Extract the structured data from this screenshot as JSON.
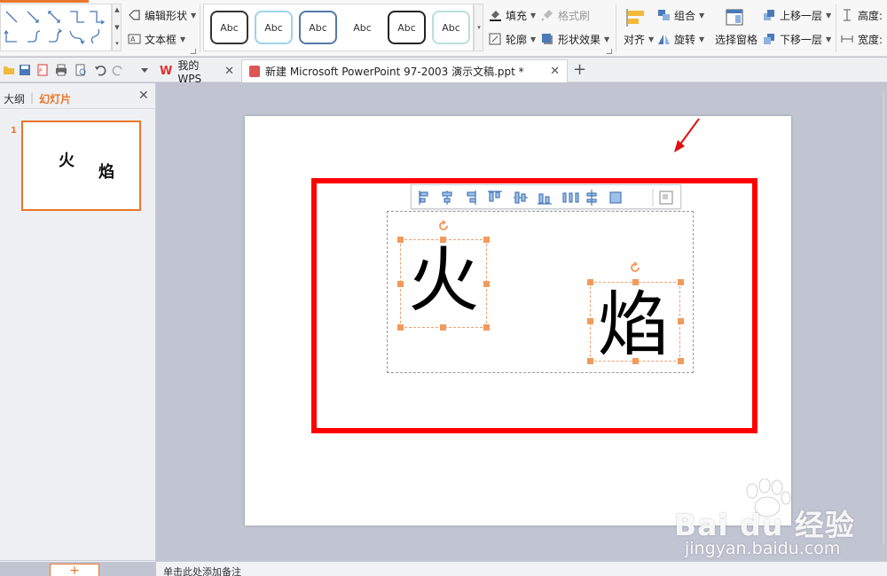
{
  "ribbon": {
    "edit_shape": "编辑形状",
    "text_box": "文本框",
    "style_samples": [
      "Abc",
      "Abc",
      "Abc",
      "Abc",
      "Abc",
      "Abc"
    ],
    "fill": "填充",
    "format_painter": "格式刷",
    "outline": "轮廓",
    "shape_effect": "形状效果",
    "align": "对齐",
    "group": "组合",
    "rotate": "旋转",
    "selection_pane": "选择窗格",
    "bring_forward": "上移一层",
    "send_backward": "下移一层",
    "height": "高度:",
    "width": "宽度:"
  },
  "tabs": {
    "wps_home": "我的WPS",
    "document": "新建 Microsoft PowerPoint 97-2003 演示文稿.ppt *"
  },
  "left_panel": {
    "outline_tab": "大纲",
    "slides_tab": "幻灯片",
    "slide_number": "1",
    "thumb_char1": "火",
    "thumb_char2": "焰",
    "add_slide": "+"
  },
  "slide": {
    "char1": "火",
    "char2": "焰"
  },
  "notes": {
    "placeholder": "单击此处添加备注"
  },
  "watermark": {
    "brand": "Bai du 经验",
    "url": "jingyan.baidu.com"
  },
  "colors": {
    "accent": "#e8762b",
    "highlight_box": "#ff0000",
    "handle": "#f29a5c",
    "canvas_bg": "#c1c5d2"
  }
}
